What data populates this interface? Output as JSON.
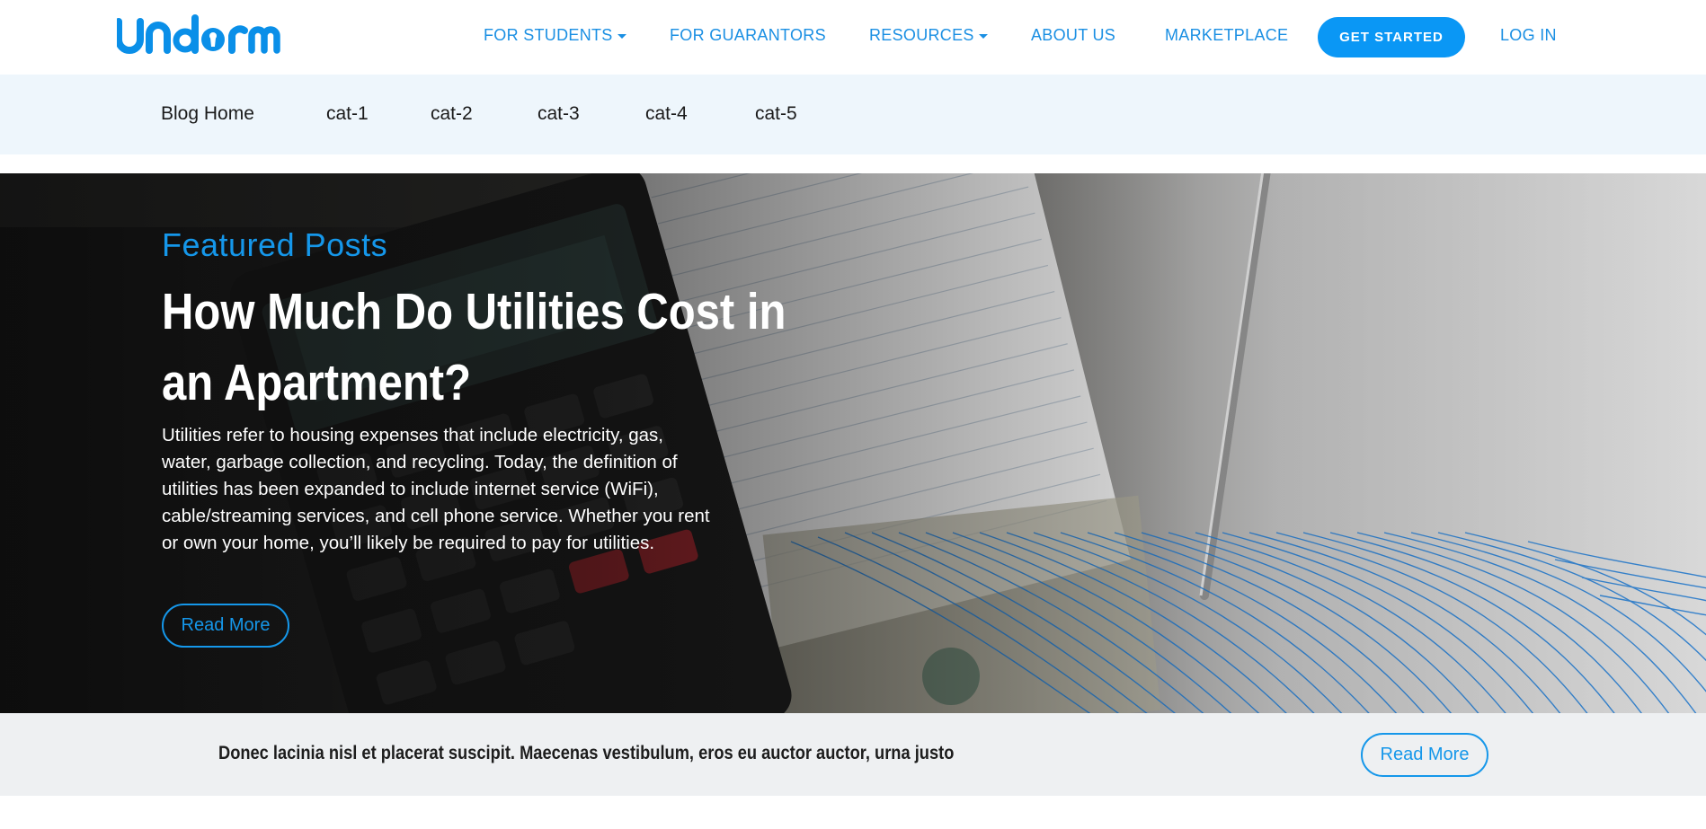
{
  "header": {
    "logo_text": "undorm",
    "nav": [
      {
        "label": "FOR STUDENTS",
        "has_dropdown": true
      },
      {
        "label": "FOR GUARANTORS",
        "has_dropdown": false
      },
      {
        "label": "RESOURCES",
        "has_dropdown": true
      },
      {
        "label": "ABOUT US",
        "has_dropdown": false
      },
      {
        "label": "MARKETPLACE",
        "has_dropdown": false
      }
    ],
    "cta_label": "GET STARTED",
    "login_label": "LOG IN"
  },
  "categories": [
    "Blog Home",
    "cat-1",
    "cat-2",
    "cat-3",
    "cat-4",
    "cat-5"
  ],
  "hero": {
    "kicker": "Featured Posts",
    "title": "How Much Do Utilities Cost in an Apartment?",
    "excerpt": "Utilities refer to housing expenses that include electricity, gas, water, garbage collection, and recycling. Today, the definition of utilities has been expanded to include internet service (WiFi), cable/streaming services, and cell phone service. Whether you rent or own your home, you’ll likely be required to pay for utilities.",
    "button_label": "Read More"
  },
  "strip": {
    "text": "Donec lacinia nisl et placerat suscipit. Maecenas vestibulum, eros eu auctor auctor, urna justo",
    "button_label": "Read More"
  },
  "colors": {
    "brand_blue": "#1597ea",
    "button_blue": "#0a97f5",
    "category_bar_bg": "#eef6fc",
    "strip_bg": "#eef0f2"
  }
}
